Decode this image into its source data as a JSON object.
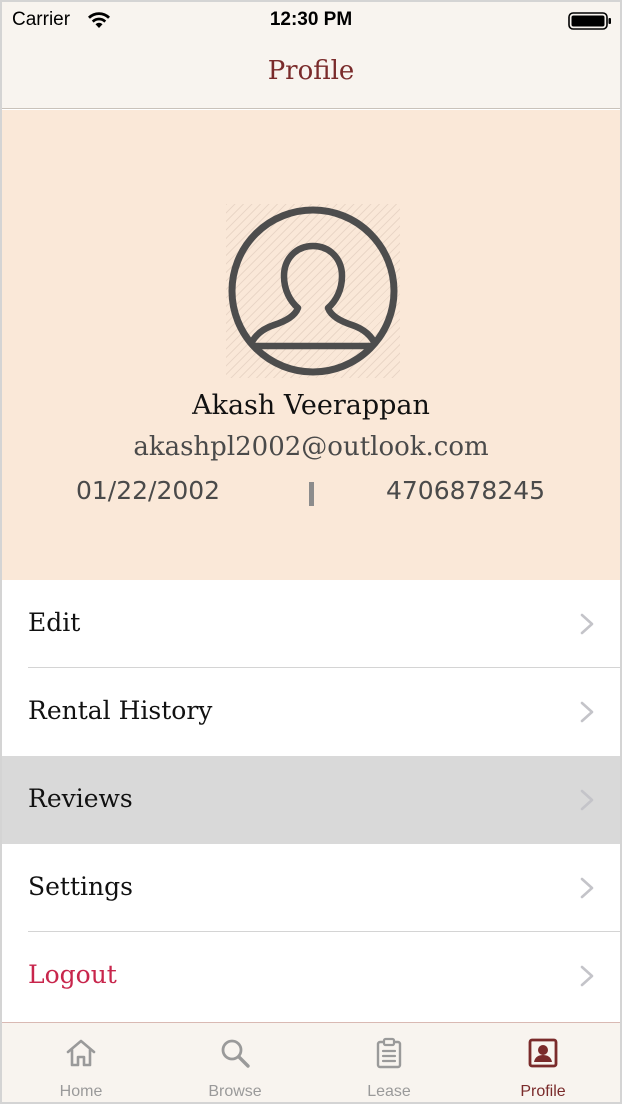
{
  "status_bar": {
    "carrier": "Carrier",
    "time": "12:30 PM"
  },
  "nav": {
    "title": "Profile"
  },
  "profile": {
    "name": "Akash Veerappan",
    "email": "akashpl2002@outlook.com",
    "dob": "01/22/2002",
    "phone": "4706878245"
  },
  "menu": {
    "items": [
      {
        "label": "Edit"
      },
      {
        "label": "Rental History"
      },
      {
        "label": "Reviews"
      },
      {
        "label": "Settings"
      },
      {
        "label": "Logout"
      }
    ],
    "selected": "Reviews"
  },
  "tabs": [
    {
      "label": "Home",
      "icon": "home-icon"
    },
    {
      "label": "Browse",
      "icon": "search-icon"
    },
    {
      "label": "Lease",
      "icon": "clipboard-icon"
    },
    {
      "label": "Profile",
      "icon": "profile-icon"
    }
  ],
  "active_tab": "Profile",
  "colors": {
    "accent": "#7a2b2b",
    "header_bg": "#fae8d8",
    "bar_bg": "#f8f4ef",
    "logout": "#c8264c",
    "selected_row": "#d9d9d9"
  }
}
